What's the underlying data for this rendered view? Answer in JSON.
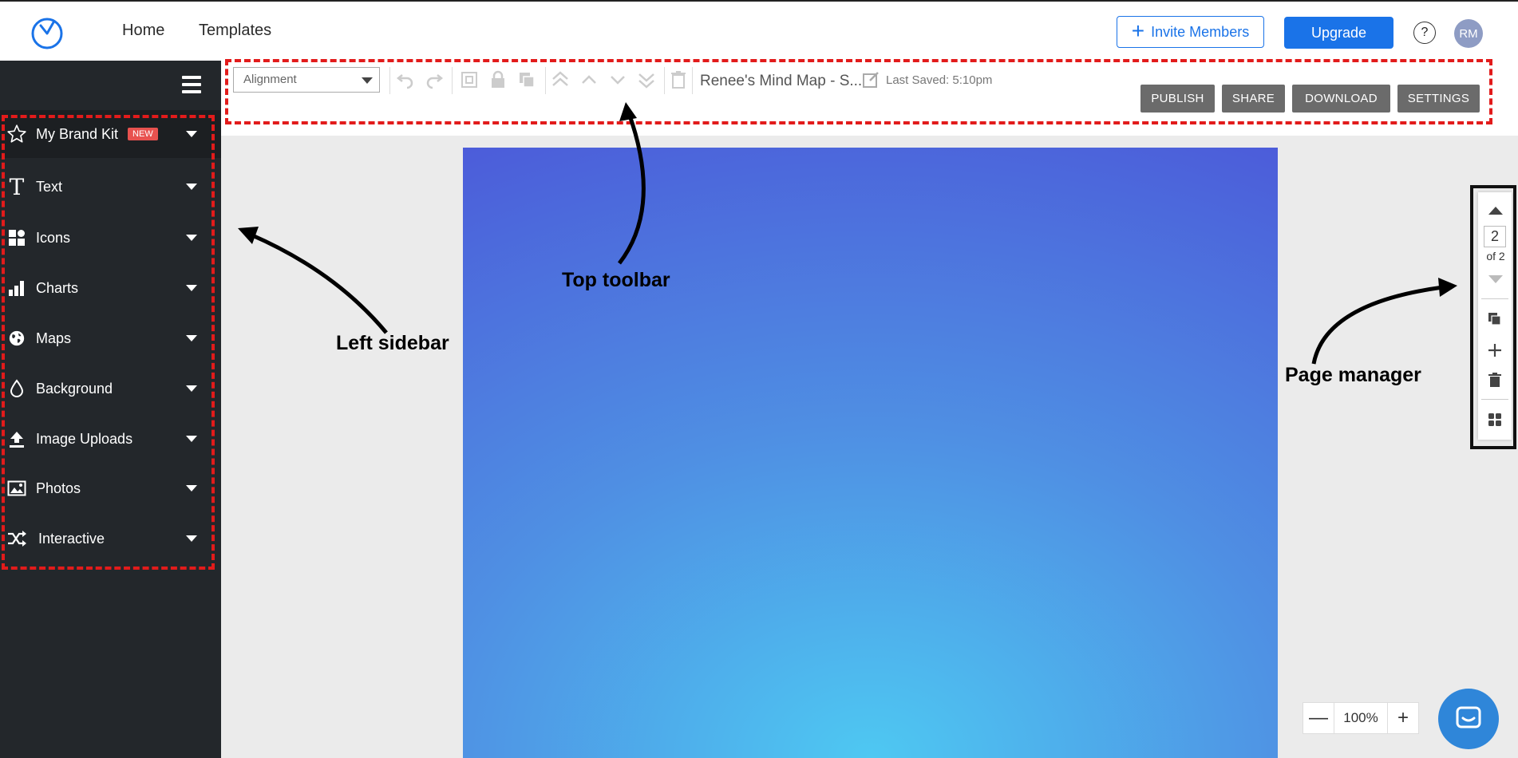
{
  "nav": {
    "home": "Home",
    "templates": "Templates",
    "invite": "Invite Members",
    "upgrade": "Upgrade",
    "help": "?",
    "avatar": "RM"
  },
  "sidebar": {
    "items": [
      {
        "label": "My Brand Kit",
        "badge": "NEW",
        "icon": "star-icon"
      },
      {
        "label": "Text",
        "icon": "text-icon"
      },
      {
        "label": "Icons",
        "icon": "shapes-icon"
      },
      {
        "label": "Charts",
        "icon": "bar-chart-icon"
      },
      {
        "label": "Maps",
        "icon": "globe-icon"
      },
      {
        "label": "Background",
        "icon": "droplet-icon"
      },
      {
        "label": "Image Uploads",
        "icon": "upload-icon"
      },
      {
        "label": "Photos",
        "icon": "image-icon"
      },
      {
        "label": "Interactive",
        "icon": "shuffle-icon"
      }
    ]
  },
  "toolbar": {
    "alignment": "Alignment",
    "doc_name": "Renee's Mind Map - S...",
    "last_saved": "Last Saved: 5:10pm",
    "publish": "PUBLISH",
    "share": "SHARE",
    "download": "DOWNLOAD",
    "settings": "SETTINGS"
  },
  "page_manager": {
    "current": "2",
    "of": "of 2"
  },
  "zoom": {
    "minus": "—",
    "value": "100%",
    "plus": "+"
  },
  "annotations": {
    "left_sidebar": "Left sidebar",
    "top_toolbar": "Top toolbar",
    "page_manager": "Page manager"
  },
  "colors": {
    "accent": "#1a73e8",
    "sidebar_bg": "#23272b",
    "highlight_dashed": "#e21b1b",
    "toolbar_button": "#6b6b6b",
    "canvas_top": "#4b55d8",
    "canvas_bottom": "#4ec8f2"
  }
}
